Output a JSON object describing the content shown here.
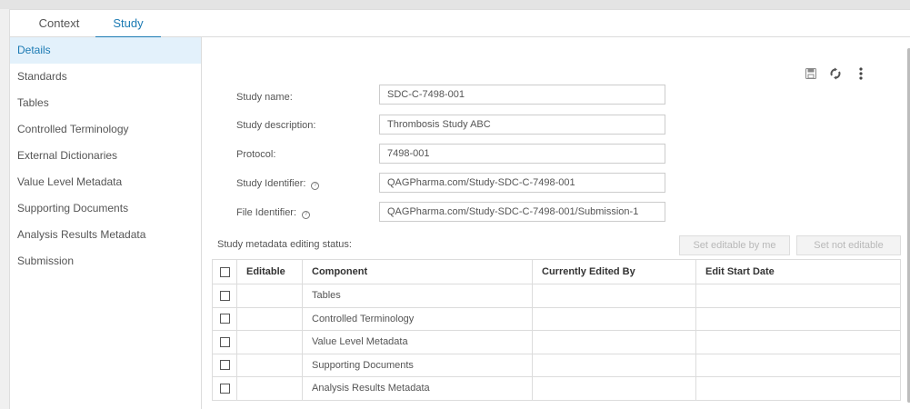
{
  "tabs": [
    {
      "label": "Context",
      "active": false
    },
    {
      "label": "Study",
      "active": true
    }
  ],
  "sidebar": {
    "items": [
      {
        "label": "Details",
        "active": true
      },
      {
        "label": "Standards"
      },
      {
        "label": "Tables"
      },
      {
        "label": "Controlled Terminology"
      },
      {
        "label": "External Dictionaries"
      },
      {
        "label": "Value Level Metadata"
      },
      {
        "label": "Supporting Documents"
      },
      {
        "label": "Analysis Results Metadata"
      },
      {
        "label": "Submission"
      }
    ]
  },
  "toolbar": {
    "icons": [
      "save-icon",
      "sync-icon",
      "more-vertical-icon"
    ]
  },
  "form": {
    "study_name_label": "Study name:",
    "study_name_value": "SDC-C-7498-001",
    "study_description_label": "Study description:",
    "study_description_value": "Thrombosis Study ABC",
    "protocol_label": "Protocol:",
    "protocol_value": "7498-001",
    "study_identifier_label": "Study Identifier:",
    "study_identifier_value": "QAGPharma.com/Study-SDC-C-7498-001",
    "file_identifier_label": "File Identifier:",
    "file_identifier_value": "QAGPharma.com/Study-SDC-C-7498-001/Submission-1"
  },
  "status": {
    "label": "Study metadata editing status:",
    "set_editable_label": "Set editable by me",
    "set_not_editable_label": "Set not editable"
  },
  "table": {
    "headers": [
      "Editable",
      "Component",
      "Currently Edited By",
      "Edit Start Date"
    ],
    "rows": [
      {
        "editable": "",
        "component": "Tables",
        "edited_by": "",
        "start_date": ""
      },
      {
        "editable": "",
        "component": "Controlled Terminology",
        "edited_by": "",
        "start_date": ""
      },
      {
        "editable": "",
        "component": "Value Level Metadata",
        "edited_by": "",
        "start_date": ""
      },
      {
        "editable": "",
        "component": "Supporting Documents",
        "edited_by": "",
        "start_date": ""
      },
      {
        "editable": "",
        "component": "Analysis Results Metadata",
        "edited_by": "",
        "start_date": ""
      }
    ]
  },
  "colors": {
    "accent": "#1b7ab3",
    "active_bg": "#e3f1fb",
    "border": "#dcdcdc"
  }
}
